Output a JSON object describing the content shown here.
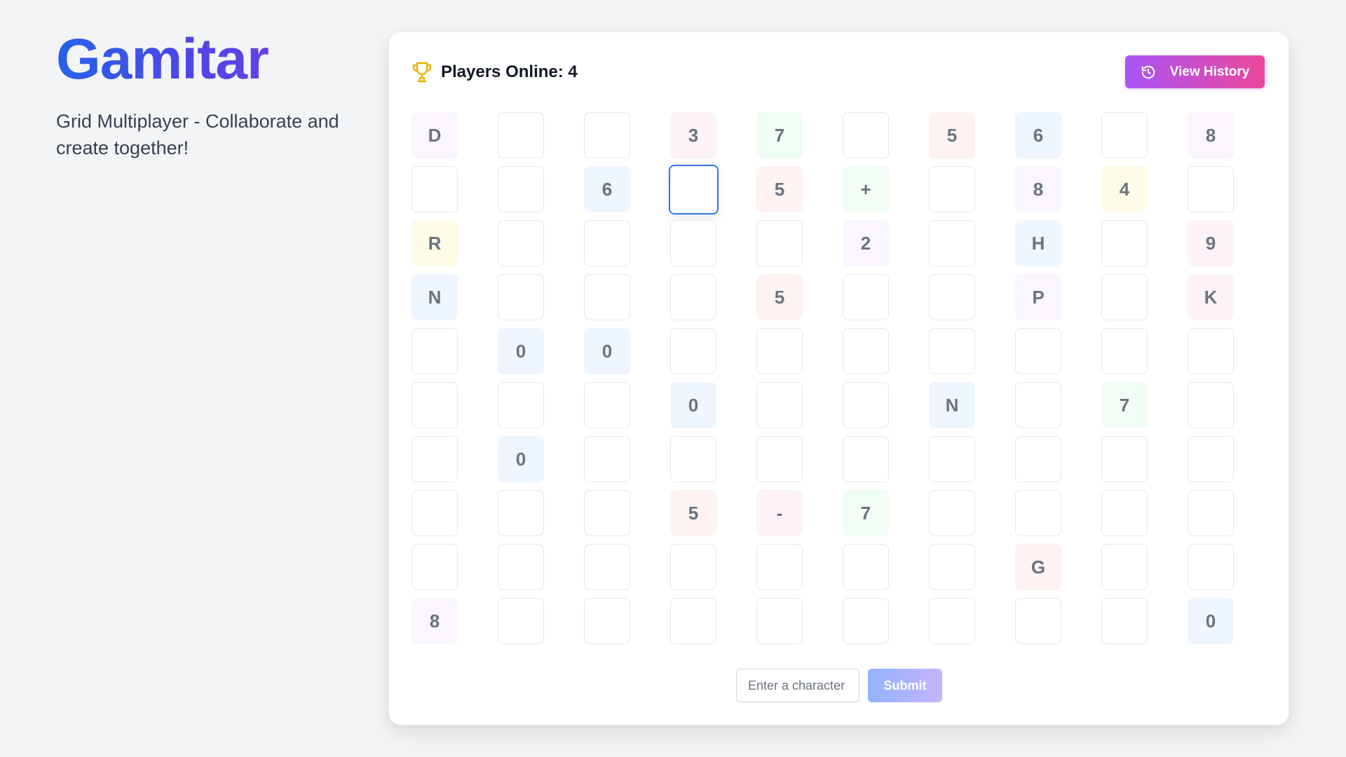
{
  "app": {
    "title": "Gamitar",
    "subtitle": "Grid Multiplayer - Collaborate and create together!"
  },
  "header": {
    "players_online": "Players Online: 4",
    "view_history_label": "View History",
    "trophy_icon": "trophy-icon",
    "history_icon": "history-icon"
  },
  "colors": {
    "pink": "#fdf2f8",
    "green": "#f0fdf4",
    "red": "#fef2f2",
    "blue": "#eff6ff",
    "purple": "#faf5ff",
    "yellow": "#fefce8",
    "selected_border": "#2b78e4",
    "history_gradient_start": "#a855f7",
    "history_gradient_end": "#ec4899"
  },
  "grid": {
    "rows": [
      [
        {
          "v": "D",
          "c": "purple"
        },
        {
          "v": "",
          "c": ""
        },
        {
          "v": "",
          "c": ""
        },
        {
          "v": "3",
          "c": "pink"
        },
        {
          "v": "7",
          "c": "green"
        },
        {
          "v": "",
          "c": ""
        },
        {
          "v": "5",
          "c": "red"
        },
        {
          "v": "6",
          "c": "blue"
        },
        {
          "v": "",
          "c": ""
        },
        {
          "v": "8",
          "c": "purple"
        }
      ],
      [
        {
          "v": "",
          "c": ""
        },
        {
          "v": "",
          "c": ""
        },
        {
          "v": "6",
          "c": "blue"
        },
        {
          "v": "",
          "c": "",
          "selected": true
        },
        {
          "v": "5",
          "c": "red"
        },
        {
          "v": "+",
          "c": "green"
        },
        {
          "v": "",
          "c": ""
        },
        {
          "v": "8",
          "c": "purple"
        },
        {
          "v": "4",
          "c": "yellow"
        },
        {
          "v": "",
          "c": ""
        }
      ],
      [
        {
          "v": "R",
          "c": "yellow"
        },
        {
          "v": "",
          "c": ""
        },
        {
          "v": "",
          "c": ""
        },
        {
          "v": "",
          "c": ""
        },
        {
          "v": "",
          "c": ""
        },
        {
          "v": "2",
          "c": "purple"
        },
        {
          "v": "",
          "c": ""
        },
        {
          "v": "H",
          "c": "blue"
        },
        {
          "v": "",
          "c": ""
        },
        {
          "v": "9",
          "c": "pink"
        }
      ],
      [
        {
          "v": "N",
          "c": "blue"
        },
        {
          "v": "",
          "c": ""
        },
        {
          "v": "",
          "c": ""
        },
        {
          "v": "",
          "c": ""
        },
        {
          "v": "5",
          "c": "red"
        },
        {
          "v": "",
          "c": ""
        },
        {
          "v": "",
          "c": ""
        },
        {
          "v": "P",
          "c": "purple"
        },
        {
          "v": "",
          "c": ""
        },
        {
          "v": "K",
          "c": "pink"
        }
      ],
      [
        {
          "v": "",
          "c": ""
        },
        {
          "v": "0",
          "c": "blue"
        },
        {
          "v": "0",
          "c": "blue"
        },
        {
          "v": "",
          "c": ""
        },
        {
          "v": "",
          "c": ""
        },
        {
          "v": "",
          "c": ""
        },
        {
          "v": "",
          "c": ""
        },
        {
          "v": "",
          "c": ""
        },
        {
          "v": "",
          "c": ""
        },
        {
          "v": "",
          "c": ""
        }
      ],
      [
        {
          "v": "",
          "c": ""
        },
        {
          "v": "",
          "c": ""
        },
        {
          "v": "",
          "c": ""
        },
        {
          "v": "0",
          "c": "blue"
        },
        {
          "v": "",
          "c": ""
        },
        {
          "v": "",
          "c": ""
        },
        {
          "v": "N",
          "c": "blue"
        },
        {
          "v": "",
          "c": ""
        },
        {
          "v": "7",
          "c": "green"
        },
        {
          "v": "",
          "c": ""
        }
      ],
      [
        {
          "v": "",
          "c": ""
        },
        {
          "v": "0",
          "c": "blue"
        },
        {
          "v": "",
          "c": ""
        },
        {
          "v": "",
          "c": ""
        },
        {
          "v": "",
          "c": ""
        },
        {
          "v": "",
          "c": ""
        },
        {
          "v": "",
          "c": ""
        },
        {
          "v": "",
          "c": ""
        },
        {
          "v": "",
          "c": ""
        },
        {
          "v": "",
          "c": ""
        }
      ],
      [
        {
          "v": "",
          "c": ""
        },
        {
          "v": "",
          "c": ""
        },
        {
          "v": "",
          "c": ""
        },
        {
          "v": "5",
          "c": "red"
        },
        {
          "v": "-",
          "c": "pink"
        },
        {
          "v": "7",
          "c": "green"
        },
        {
          "v": "",
          "c": ""
        },
        {
          "v": "",
          "c": ""
        },
        {
          "v": "",
          "c": ""
        },
        {
          "v": "",
          "c": ""
        }
      ],
      [
        {
          "v": "",
          "c": ""
        },
        {
          "v": "",
          "c": ""
        },
        {
          "v": "",
          "c": ""
        },
        {
          "v": "",
          "c": ""
        },
        {
          "v": "",
          "c": ""
        },
        {
          "v": "",
          "c": ""
        },
        {
          "v": "",
          "c": ""
        },
        {
          "v": "G",
          "c": "red"
        },
        {
          "v": "",
          "c": ""
        },
        {
          "v": "",
          "c": ""
        }
      ],
      [
        {
          "v": "8",
          "c": "purple"
        },
        {
          "v": "",
          "c": ""
        },
        {
          "v": "",
          "c": ""
        },
        {
          "v": "",
          "c": ""
        },
        {
          "v": "",
          "c": ""
        },
        {
          "v": "",
          "c": ""
        },
        {
          "v": "",
          "c": ""
        },
        {
          "v": "",
          "c": ""
        },
        {
          "v": "",
          "c": ""
        },
        {
          "v": "0",
          "c": "blue"
        }
      ]
    ]
  },
  "form": {
    "input_value": "",
    "input_placeholder": "Enter a character",
    "submit_label": "Submit"
  }
}
